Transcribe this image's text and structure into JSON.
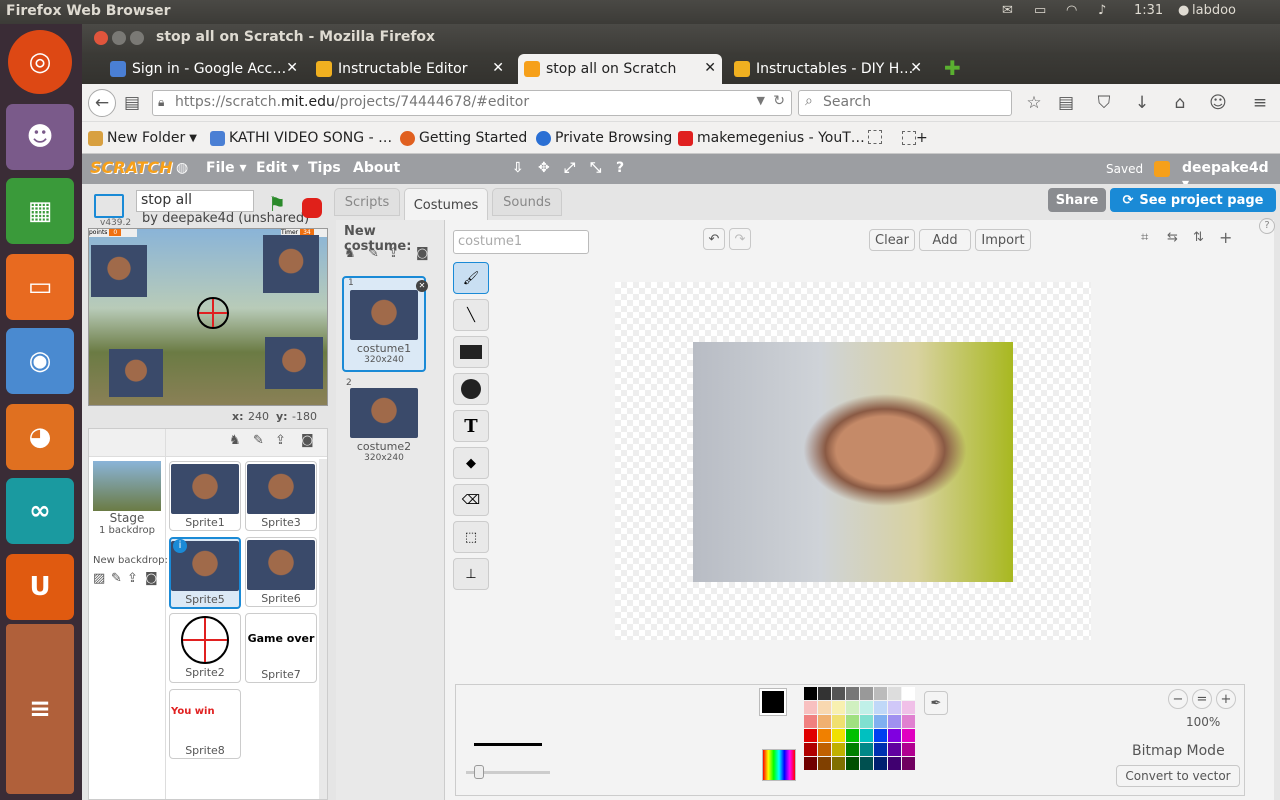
{
  "os": {
    "app_title": "Firefox Web Browser",
    "clock": "1:31",
    "user": "labdoo"
  },
  "window": {
    "title": "stop all on Scratch - Mozilla Firefox"
  },
  "tabs": [
    {
      "label": "Sign in - Google Acc…",
      "favicon_color": "#4a7fd4"
    },
    {
      "label": "Instructable Editor",
      "favicon_color": "#f0b020"
    },
    {
      "label": "stop all on Scratch",
      "favicon_color": "#f6a01a"
    },
    {
      "label": "Instructables - DIY H…",
      "favicon_color": "#f0b020"
    }
  ],
  "nav": {
    "url_prefix": "https://scratch.",
    "url_host": "mit.edu",
    "url_path": "/projects/74444678/#editor",
    "search_placeholder": "Search"
  },
  "bookmarks": [
    {
      "label": "New Folder",
      "icon": "folder-icon",
      "color": "#d8a040"
    },
    {
      "label": "KATHI VIDEO SONG - …",
      "icon": "google-icon",
      "color": "#4a7fd4"
    },
    {
      "label": "Getting Started",
      "icon": "firefox-icon",
      "color": "#e06020"
    },
    {
      "label": "Private Browsing",
      "icon": "help-icon",
      "color": "#2a6fd4"
    },
    {
      "label": "makemegenius - YouT…",
      "icon": "youtube-icon",
      "color": "#e02020"
    }
  ],
  "scratch_menu": {
    "logo": "SCRATCH",
    "file": "File",
    "edit": "Edit",
    "tips": "Tips",
    "about": "About",
    "saved": "Saved",
    "username": "deepake4d",
    "share": "Share",
    "see_project": "See project page"
  },
  "project": {
    "title": "stop all",
    "version": "v439.2",
    "author": "by deepake4d (unshared)",
    "var_points": "points",
    "var_points_value": "0",
    "var_timer": "Timer",
    "var_timer_value": "34",
    "x_label": "x:",
    "x_value": "240",
    "y_label": "y:",
    "y_value": "-180"
  },
  "editor_tabs": {
    "scripts": "Scripts",
    "costumes": "Costumes",
    "sounds": "Sounds"
  },
  "sprites": {
    "stage_label": "Stage",
    "stage_sub": "1 backdrop",
    "new_backdrop": "New backdrop:",
    "items": [
      {
        "name": "Sprite1"
      },
      {
        "name": "Sprite3"
      },
      {
        "name": "Sprite5"
      },
      {
        "name": "Sprite6"
      },
      {
        "name": "Sprite2"
      },
      {
        "name": "Sprite7",
        "text": "Game over"
      },
      {
        "name": "Sprite8",
        "text": "You win"
      }
    ]
  },
  "costumes": {
    "new_costume": "New costume:",
    "items": [
      {
        "index": "1",
        "name": "costume1",
        "size": "320x240"
      },
      {
        "index": "2",
        "name": "costume2",
        "size": "320x240"
      }
    ]
  },
  "paint": {
    "costume_name": "costume1",
    "clear": "Clear",
    "add": "Add",
    "import": "Import",
    "zoom": "100%",
    "mode": "Bitmap Mode",
    "convert": "Convert to vector",
    "stroke_color": "#000000"
  }
}
